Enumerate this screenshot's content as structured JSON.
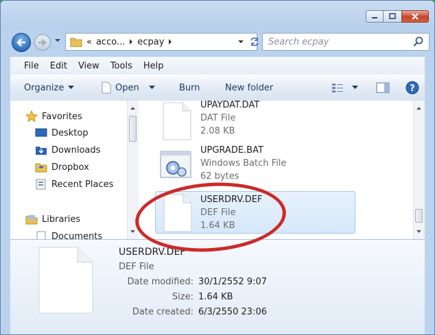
{
  "address": {
    "prefix": "«",
    "crumbs": [
      "acco...",
      "ecpay"
    ]
  },
  "search": {
    "placeholder": "Search ecpay"
  },
  "menu": [
    "File",
    "Edit",
    "View",
    "Tools",
    "Help"
  ],
  "commands": {
    "organize": "Organize",
    "open": "Open",
    "burn": "Burn",
    "new_folder": "New folder"
  },
  "nav": {
    "favorites": "Favorites",
    "items": [
      "Desktop",
      "Downloads",
      "Dropbox",
      "Recent Places"
    ],
    "libraries": "Libraries",
    "documents": "Documents"
  },
  "files": [
    {
      "name": "UPAYDAT.DAT",
      "type": "DAT File",
      "size": "2.08 KB"
    },
    {
      "name": "UPGRADE.BAT",
      "type": "Windows Batch File",
      "size": "62 bytes"
    },
    {
      "name": "USERDRV.DEF",
      "type": "DEF File",
      "size": "1.64 KB"
    }
  ],
  "details": {
    "name": "USERDRV.DEF",
    "type": "DEF File",
    "modified_label": "Date modified:",
    "modified": "30/1/2552 9:07",
    "size_label": "Size:",
    "size": "1.64 KB",
    "created_label": "Date created:",
    "created": "6/3/2550 23:06"
  },
  "colors": {
    "highlight_ring": "#cc2a2a",
    "selection": "#d6e8fb"
  }
}
